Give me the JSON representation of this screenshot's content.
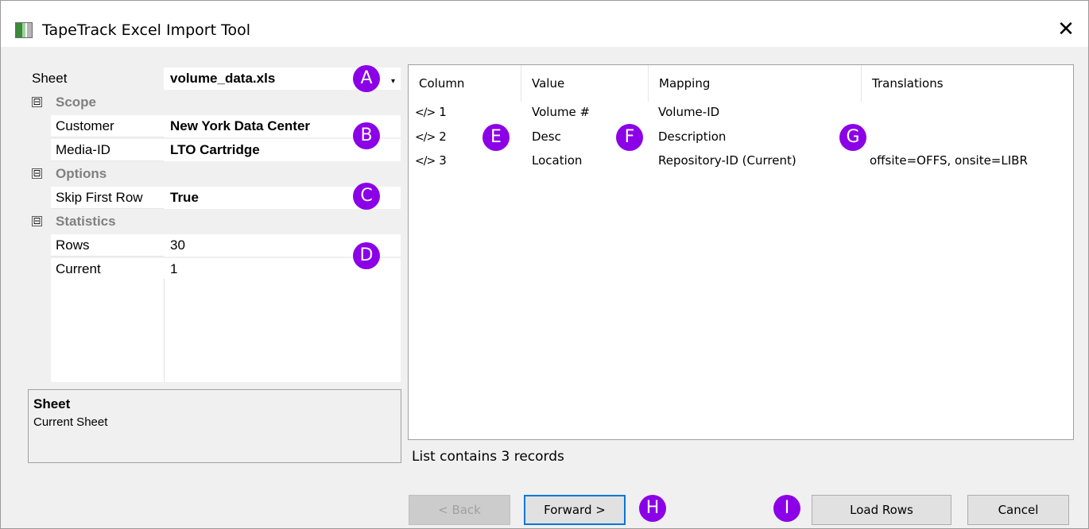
{
  "window": {
    "title": "TapeTrack Excel Import Tool",
    "close_glyph": "✕",
    "icon": "excel-sheet-icon"
  },
  "property_grid": {
    "sheet_label": "Sheet",
    "sheet_value": "volume_data.xls",
    "dropdown_glyph": "▾",
    "collapse_glyph": "⊟",
    "categories": {
      "scope": "Scope",
      "options": "Options",
      "statistics": "Statistics"
    },
    "customer_label": "Customer",
    "customer_value": "New York Data Center",
    "media_label": "Media-ID",
    "media_value": "LTO Cartridge",
    "skip_label": "Skip First Row",
    "skip_value": "True",
    "rows_label": "Rows",
    "rows_value": "30",
    "current_label": "Current",
    "current_value": "1"
  },
  "help": {
    "title": "Sheet",
    "description": "Current Sheet"
  },
  "list": {
    "headers": [
      "Column",
      "Value",
      "Mapping",
      "Translations"
    ],
    "code_glyph": "</>",
    "rows": [
      {
        "column": "1",
        "value": "Volume #",
        "mapping": "Volume-ID",
        "translation": ""
      },
      {
        "column": "2",
        "value": "Desc",
        "mapping": "Description",
        "translation": ""
      },
      {
        "column": "3",
        "value": "Location",
        "mapping": "Repository-ID (Current)",
        "translation": "offsite=OFFS, onsite=LIBR"
      }
    ],
    "status": "List contains 3 records"
  },
  "buttons": {
    "back": "< Back",
    "forward": "Forward >",
    "load_rows": "Load Rows",
    "cancel": "Cancel"
  },
  "badges": [
    "A",
    "B",
    "C",
    "D",
    "E",
    "F",
    "G",
    "H",
    "I"
  ],
  "colors": {
    "badge": "#8b00e6",
    "focus": "#0078d7"
  }
}
